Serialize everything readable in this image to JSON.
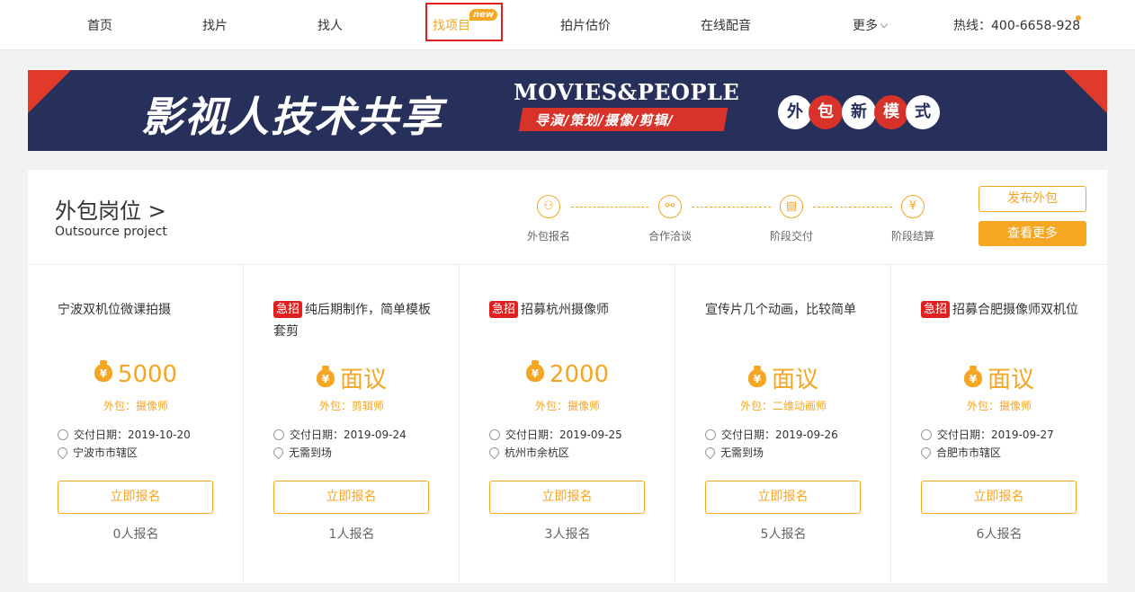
{
  "nav": {
    "items": [
      "首页",
      "找片",
      "找人",
      "找项目",
      "拍片估价",
      "在线配音",
      "更多"
    ],
    "new_badge": "new",
    "hotline": "热线：400-6658-928"
  },
  "banner": {
    "title": "影视人技术共享",
    "en_title": "MOVIES&PEOPLE",
    "ribbon": "导演/策划/摄像/剪辑/",
    "circles": [
      "外",
      "包",
      "新",
      "模",
      "式"
    ]
  },
  "section": {
    "title": "外包岗位 >",
    "subtitle": "Outsource project",
    "steps": [
      "外包报名",
      "合作洽谈",
      "阶段交付",
      "阶段结算"
    ],
    "publish_button": "发布外包",
    "more_button": "查看更多"
  },
  "cards": [
    {
      "urgent": false,
      "tag": "",
      "title": "宁波双机位微课拍摄",
      "price": "5000",
      "role": "外包：摄像师",
      "date": "交付日期：2019-10-20",
      "location": "宁波市市辖区",
      "button": "立即报名",
      "count": "0人报名"
    },
    {
      "urgent": true,
      "tag": "急招",
      "title": "纯后期制作，简单模板套剪",
      "price": "面议",
      "role": "外包：剪辑师",
      "date": "交付日期：2019-09-24",
      "location": "无需到场",
      "button": "立即报名",
      "count": "1人报名"
    },
    {
      "urgent": true,
      "tag": "急招",
      "title": "招募杭州摄像师",
      "price": "2000",
      "role": "外包：摄像师",
      "date": "交付日期：2019-09-25",
      "location": "杭州市余杭区",
      "button": "立即报名",
      "count": "3人报名"
    },
    {
      "urgent": false,
      "tag": "",
      "title": "宣传片几个动画，比较简单",
      "price": "面议",
      "role": "外包：二维动画师",
      "date": "交付日期：2019-09-26",
      "location": "无需到场",
      "button": "立即报名",
      "count": "5人报名"
    },
    {
      "urgent": true,
      "tag": "急招",
      "title": "招募合肥摄像师双机位",
      "price": "面议",
      "role": "外包：摄像师",
      "date": "交付日期：2019-09-27",
      "location": "合肥市市辖区",
      "button": "立即报名",
      "count": "6人报名"
    }
  ],
  "colors": {
    "accent": "#f5a623",
    "urgent": "#e02020",
    "banner_bg": "#27305a"
  }
}
